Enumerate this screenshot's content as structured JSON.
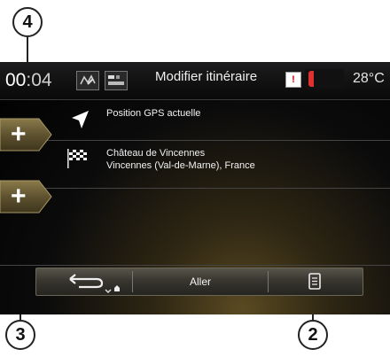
{
  "status_bar": {
    "time": "00:04",
    "time_prefix": "00",
    "time_suffix": ":04",
    "title": "Modifier itinéraire",
    "temperature": "28°C"
  },
  "route": [
    {
      "icon": "navigation-arrow-icon",
      "lines": [
        "Position GPS actuelle"
      ]
    },
    {
      "icon": "checkered-flag-icon",
      "lines": [
        "Château de Vincennes",
        "Vincennes (Val-de-Marne), France"
      ]
    }
  ],
  "add_button_glyph": "+",
  "bottom_bar": {
    "go_label": "Aller"
  },
  "callouts": [
    "4",
    "3",
    "2"
  ],
  "colors": {
    "accent_gold": "#6b5a2a",
    "screen_bg": "#000000",
    "text": "#f2f2f2"
  }
}
